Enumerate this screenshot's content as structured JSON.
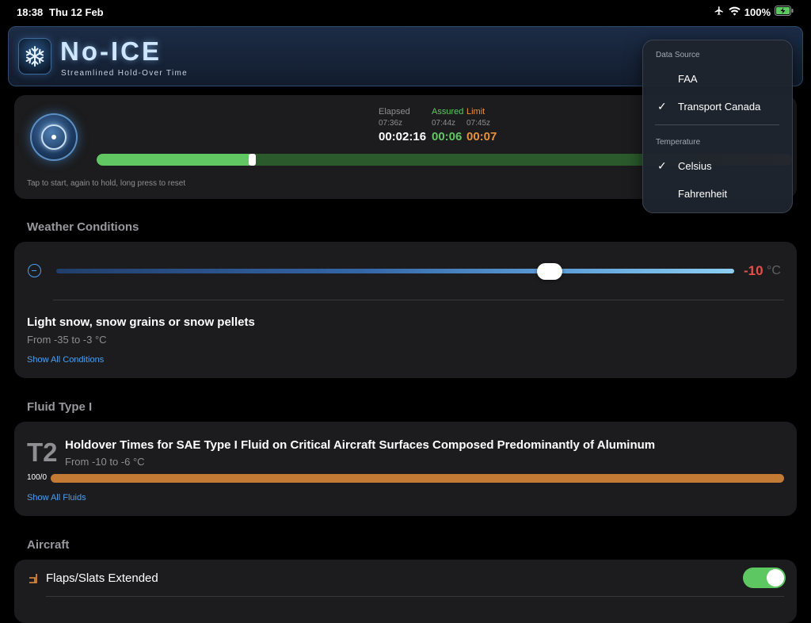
{
  "status_bar": {
    "time": "18:38",
    "date": "Thu 12 Feb",
    "battery": "100%",
    "icons": [
      "airplane-icon",
      "wifi-icon",
      "battery-charging-icon"
    ]
  },
  "header": {
    "title": "No-ICE",
    "subtitle": "Streamlined Hold-Over Time",
    "icon": "snowflake-icon"
  },
  "timer": {
    "elapsed_label": "Elapsed",
    "elapsed_time": "07:36z",
    "elapsed_value": "00:02:16",
    "assured_label": "Assured",
    "assured_time": "07:44z",
    "assured_value": "00:06",
    "limit_label": "Limit",
    "limit_time": "07:45z",
    "limit_value": "00:07",
    "hint": "Tap to start, again to hold, long press to reset",
    "progress_fraction": 0.227
  },
  "weather": {
    "section_title": "Weather Conditions",
    "temperature": "-10",
    "unit": "°C",
    "condition_title": "Light snow, snow grains or snow pellets",
    "condition_range": "From -35 to -3 °C",
    "show_all": "Show All Conditions"
  },
  "fluid": {
    "section_title": "Fluid Type I",
    "code": "T2",
    "title": "Holdover Times for SAE Type I Fluid on Critical Aircraft Surfaces Composed Predominantly of Aluminum",
    "range": "From -10 to -6 °C",
    "mix_label": "100/0",
    "show_all": "Show All Fluids"
  },
  "aircraft": {
    "section_title": "Aircraft",
    "flaps_label": "Flaps/Slats Extended",
    "flaps_enabled": true
  },
  "menu": {
    "data_source_header": "Data Source",
    "data_source_options": [
      {
        "label": "FAA",
        "selected": false
      },
      {
        "label": "Transport Canada",
        "selected": true
      }
    ],
    "temperature_header": "Temperature",
    "temperature_options": [
      {
        "label": "Celsius",
        "selected": true
      },
      {
        "label": "Fahrenheit",
        "selected": false
      }
    ],
    "checkmark": "✓"
  },
  "colors": {
    "accent_blue": "#4b9ff0",
    "assured_green": "#61c763",
    "limit_orange": "#e8913b",
    "temp_red": "#e25049"
  }
}
